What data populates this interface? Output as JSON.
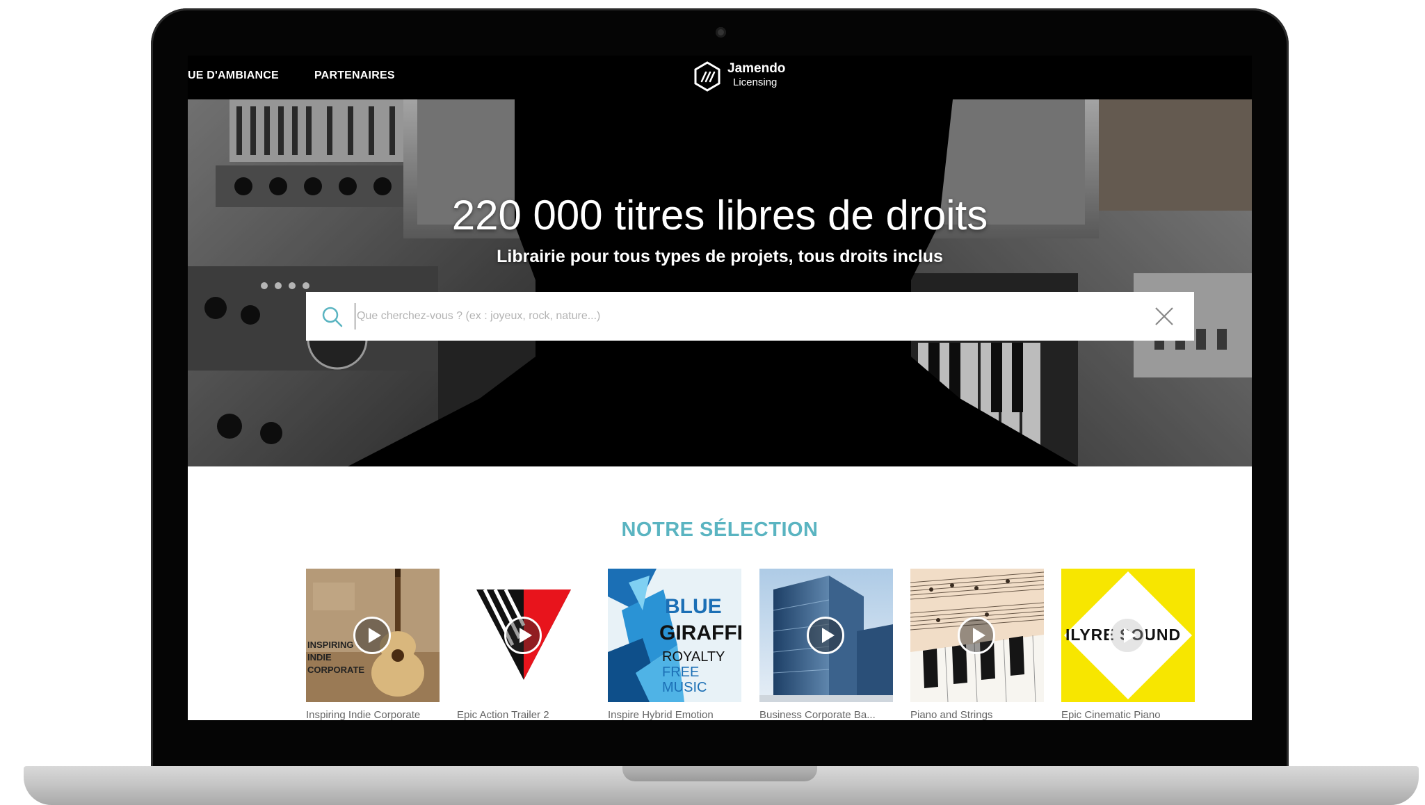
{
  "nav": {
    "ambiance_label": "UE D'AMBIANCE",
    "partners_label": "PARTENAIRES"
  },
  "logo": {
    "name": "Jamendo",
    "sub": "Licensing"
  },
  "hero": {
    "title": "220 000 titres libres de droits",
    "subtitle": "Librairie pour tous types de projets, tous droits inclus"
  },
  "search": {
    "placeholder": "Que cherchez-vous ? (ex : joyeux, rock, nature...)",
    "value": ""
  },
  "selection": {
    "title": "NOTRE SÉLECTION",
    "items": [
      {
        "title": "Inspiring Indie Corporate",
        "art_text": [
          "INSPIRING",
          "INDIE",
          "CORPORATE"
        ]
      },
      {
        "title": "Epic Action Trailer 2"
      },
      {
        "title": "Inspire Hybrid Emotion",
        "art_text": [
          "BLUE",
          "GIRAFFE",
          "ROYALTY",
          "FREE",
          "MUSIC"
        ]
      },
      {
        "title": "Business Corporate Ba..."
      },
      {
        "title": "Piano and Strings"
      },
      {
        "title": "Epic Cinematic Piano",
        "art_text": [
          "ILYRE SOUND"
        ]
      }
    ]
  },
  "colors": {
    "accent": "#5ab4c1",
    "header_bg": "#000000",
    "card6_bg": "#f7e600"
  },
  "icons": {
    "search": "search-icon",
    "clear": "close-icon",
    "play": "play-icon",
    "logo": "jamendo-logo-icon"
  }
}
